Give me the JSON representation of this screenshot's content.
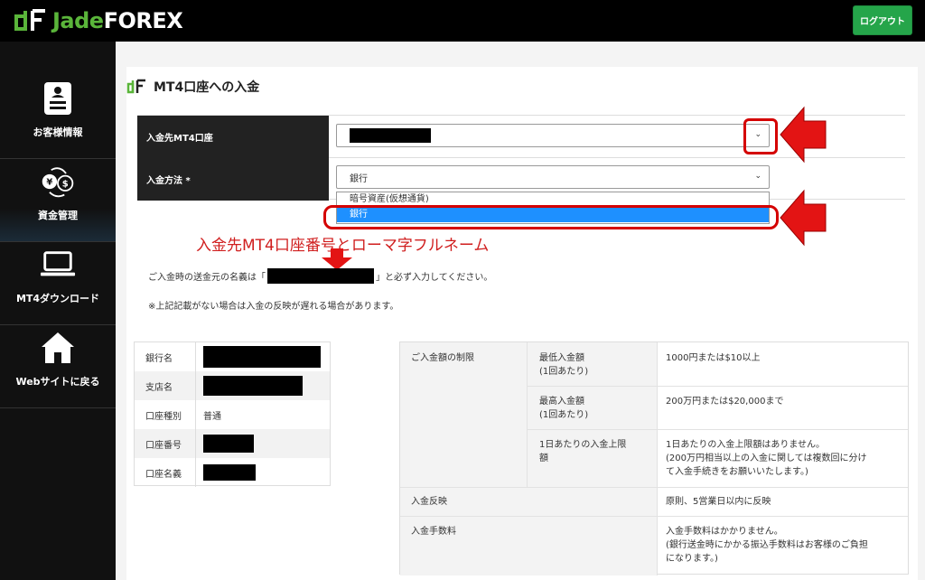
{
  "header": {
    "logo_part1": "Jade",
    "logo_part2": "FOREX",
    "logout_label": "ログアウト"
  },
  "sidebar": {
    "items": [
      {
        "label": "お客様情報",
        "icon": "document-icon"
      },
      {
        "label": "資金管理",
        "icon": "currency-exchange-icon"
      },
      {
        "label": "MT4ダウンロード",
        "icon": "laptop-icon"
      },
      {
        "label": "Webサイトに戻る",
        "icon": "home-icon"
      }
    ]
  },
  "page": {
    "title": "MT4口座への入金"
  },
  "form": {
    "account_label": "入金先MT4口座",
    "method_label": "入金方法 *",
    "method_value": "銀行",
    "method_options": [
      "暗号資産(仮想通貨)",
      "銀行"
    ]
  },
  "annotation": {
    "text": "入金先MT4口座番号とローマ字フルネーム"
  },
  "notes": {
    "note1_before": "ご入金時の送金元の名義は「",
    "note1_after": "」と必ず入力してください。",
    "note2": "※上記記載がない場合は入金の反映が遅れる場合があります。"
  },
  "bank_info": {
    "rows": [
      {
        "key": "銀行名",
        "value": ""
      },
      {
        "key": "支店名",
        "value": ""
      },
      {
        "key": "口座種別",
        "value": "普通"
      },
      {
        "key": "口座番号",
        "value": ""
      },
      {
        "key": "口座名義",
        "value": ""
      }
    ]
  },
  "limits": {
    "section_label": "ご入金額の制限",
    "min_label_1": "最低入金額",
    "min_label_2": "(1回あたり)",
    "min_value": "1000円または$10以上",
    "max_label_1": "最高入金額",
    "max_label_2": "(1回あたり)",
    "max_value": "200万円または$20,000まで",
    "daily_label_1": "1日あたりの入金上限",
    "daily_label_2": "額",
    "daily_value_1": "1日あたりの入金上限額はありません。",
    "daily_value_2": "(200万円相当以上の入金に関しては複数回に分け",
    "daily_value_3": "て入金手続きをお願いいたします。)",
    "reflect_label": "入金反映",
    "reflect_value": "原則、5営業日以内に反映",
    "fee_label": "入金手数料",
    "fee_value_1": "入金手数料はかかりません。",
    "fee_value_2": "(銀行送金時にかかる振込手数料はお客様のご負担",
    "fee_value_3": "になります。)"
  },
  "colors": {
    "brand_green": "#5ab53a",
    "logout_green": "#25a54a",
    "selected_blue": "#1e90ff",
    "annotation_red": "#d40000"
  }
}
